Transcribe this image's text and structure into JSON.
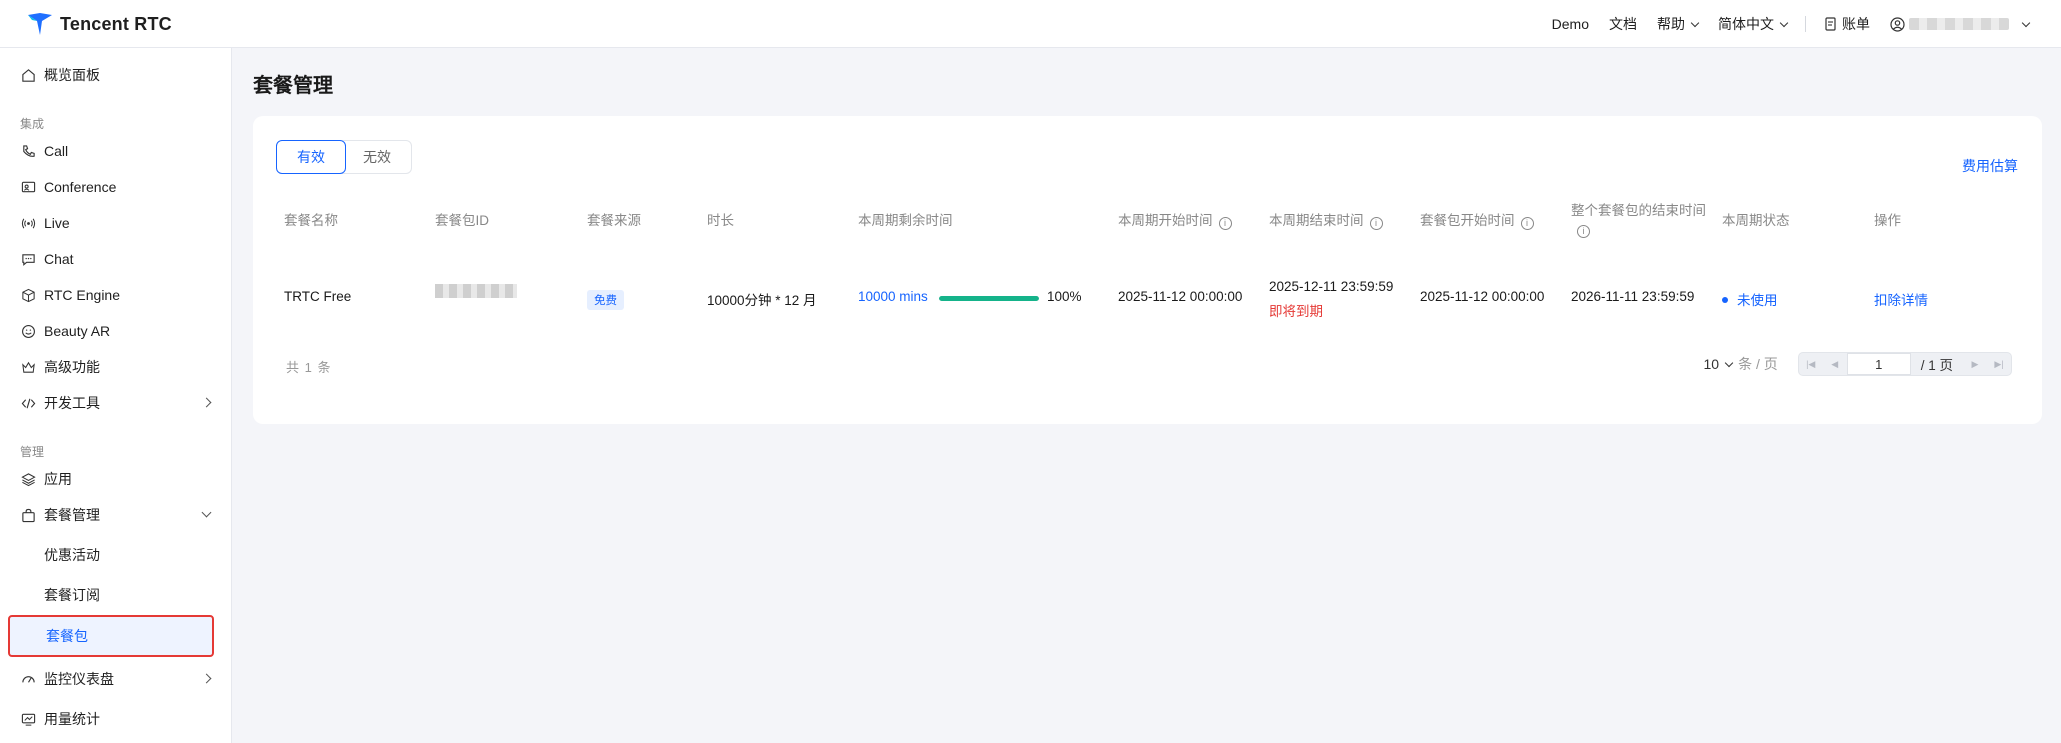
{
  "brand": {
    "name": "Tencent RTC"
  },
  "topnav": {
    "demo": "Demo",
    "docs": "文档",
    "help": "帮助",
    "language": "简体中文",
    "billing": "账单"
  },
  "sidebar": {
    "overview": "概览面板",
    "group_integration": "集成",
    "call": "Call",
    "conference": "Conference",
    "live": "Live",
    "chat": "Chat",
    "rtc_engine": "RTC Engine",
    "beauty_ar": "Beauty AR",
    "advanced": "高级功能",
    "devtools": "开发工具",
    "group_manage": "管理",
    "apps": "应用",
    "package_mgmt": "套餐管理",
    "promotions": "优惠活动",
    "subscriptions": "套餐订阅",
    "packages": "套餐包",
    "monitor": "监控仪表盘",
    "usage": "用量统计"
  },
  "page": {
    "title": "套餐管理",
    "tab_valid": "有效",
    "tab_invalid": "无效",
    "estimate": "费用估算"
  },
  "table": {
    "headers": {
      "name": "套餐名称",
      "id": "套餐包ID",
      "source": "套餐来源",
      "duration": "时长",
      "remaining": "本周期剩余时间",
      "start": "本周期开始时间",
      "end": "本周期结束时间",
      "pkg_start": "套餐包开始时间",
      "pkg_end": "整个套餐包的结束时间",
      "status": "本周期状态",
      "action": "操作"
    },
    "row": {
      "name": "TRTC Free",
      "source": "免费",
      "duration": "10000分钟 * 12 月",
      "remaining": "10000 mins",
      "remaining_progress": 1.0,
      "remaining_pct": "100%",
      "start": "2025-11-12 00:00:00",
      "end": "2025-12-11 23:59:59",
      "end_warning": "即将到期",
      "pkg_start": "2025-11-12 00:00:00",
      "pkg_end": "2026-11-11 23:59:59",
      "status": "未使用",
      "action": "扣除详情"
    }
  },
  "footer": {
    "total": "共 1 条",
    "page_size": "10",
    "page_size_unit": "条 / 页",
    "page_value": "1",
    "page_total": "/ 1 页"
  },
  "colors": {
    "accent": "#1664ff",
    "progress": "#15b38a",
    "warning": "#e53935"
  }
}
